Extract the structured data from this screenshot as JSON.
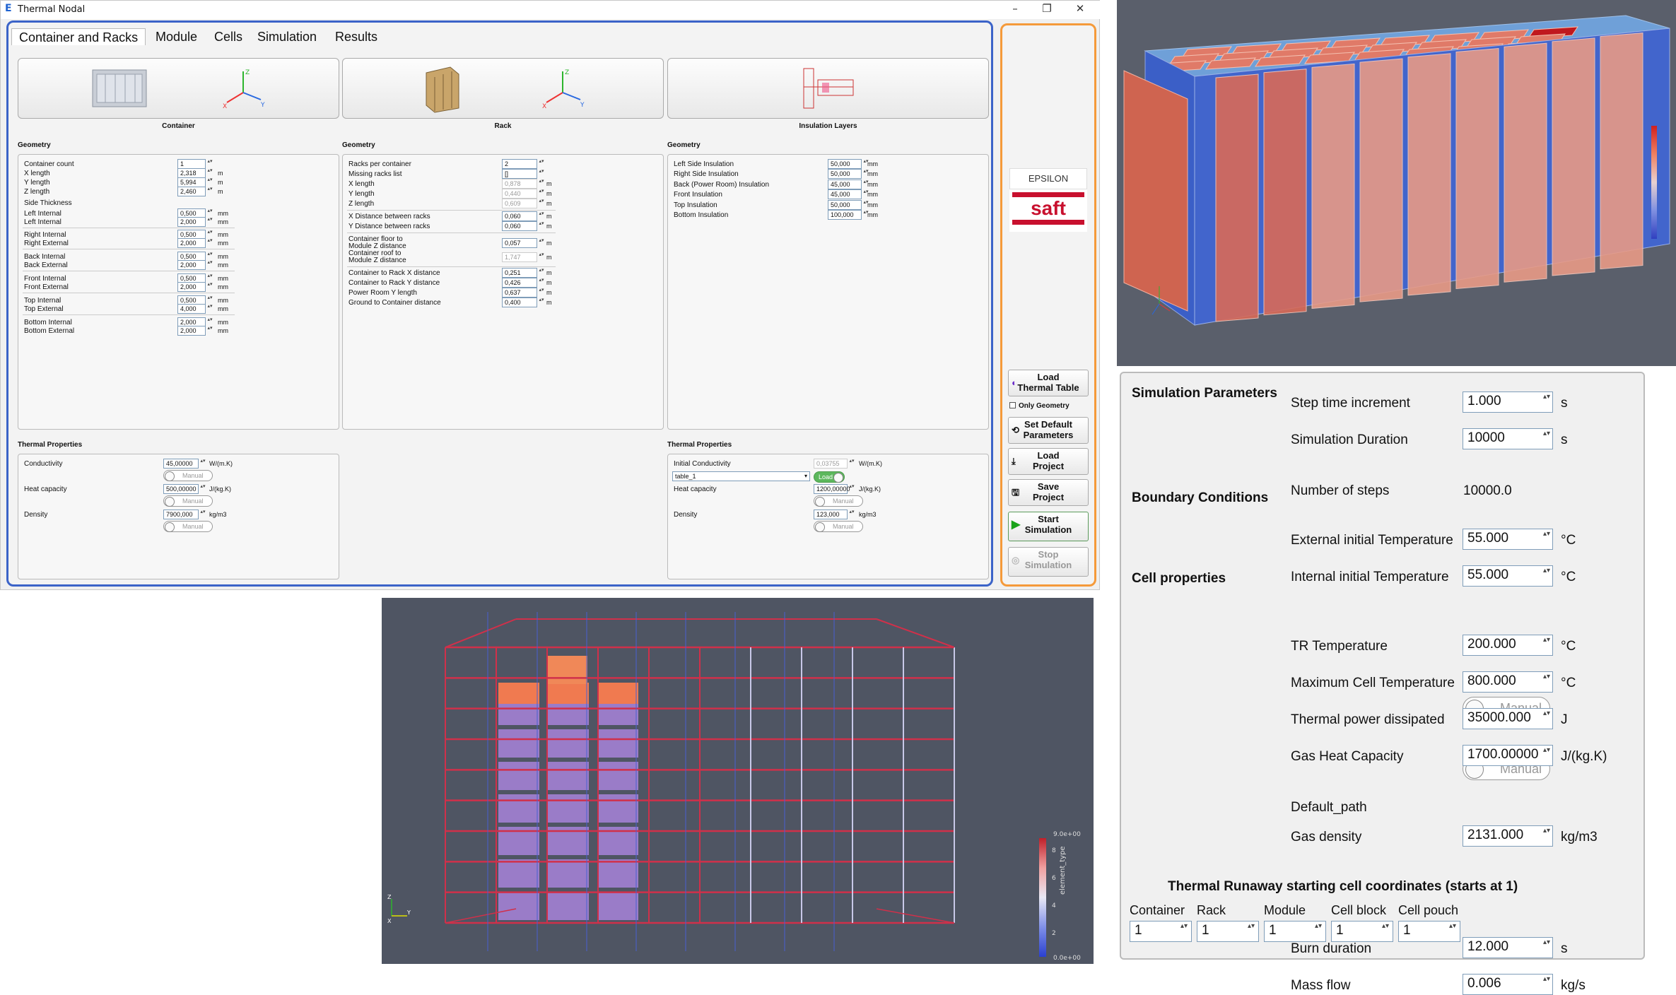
{
  "window": {
    "title": "Thermal Nodal"
  },
  "tabs": [
    "Container and Racks",
    "Module",
    "Cells",
    "Simulation",
    "Results"
  ],
  "columns": {
    "container": {
      "caption": "Container"
    },
    "rack": {
      "caption": "Rack"
    },
    "insulation": {
      "caption": "Insulation Layers"
    }
  },
  "section": {
    "geometry": "Geometry",
    "thermal": "Thermal Properties"
  },
  "container_geom": [
    {
      "label": "Container count",
      "value": "1",
      "unit": ""
    },
    {
      "label": "X length",
      "value": "2,318",
      "unit": "m"
    },
    {
      "label": "Y length",
      "value": "5,994",
      "unit": "m"
    },
    {
      "label": "Z length",
      "value": "2,460",
      "unit": "m"
    }
  ],
  "side_thickness": "Side Thickness",
  "thickness": [
    {
      "label": "Left Internal",
      "value": "0,500",
      "unit": "mm"
    },
    {
      "label": "Left Internal",
      "value": "2,000",
      "unit": "mm"
    },
    {
      "label": "Right Internal",
      "value": "0,500",
      "unit": "mm"
    },
    {
      "label": "Right External",
      "value": "2,000",
      "unit": "mm"
    },
    {
      "label": "Back Internal",
      "value": "0,500",
      "unit": "mm"
    },
    {
      "label": "Back External",
      "value": "2,000",
      "unit": "mm"
    },
    {
      "label": "Front Internal",
      "value": "0,500",
      "unit": "mm"
    },
    {
      "label": "Front External",
      "value": "2,000",
      "unit": "mm"
    },
    {
      "label": "Top Internal",
      "value": "0,500",
      "unit": "mm"
    },
    {
      "label": "Top External",
      "value": "4,000",
      "unit": "mm"
    },
    {
      "label": "Bottom Internal",
      "value": "2,000",
      "unit": "mm"
    },
    {
      "label": "Bottom External",
      "value": "2,000",
      "unit": "mm"
    }
  ],
  "container_thermal": [
    {
      "label": "Conductivity",
      "value": "45,00000",
      "unit": "W/(m.K)",
      "toggle": "Manual"
    },
    {
      "label": "Heat capacity",
      "value": "500,00000",
      "unit": "J/(kg.K)",
      "toggle": "Manual"
    },
    {
      "label": "Density",
      "value": "7900,000",
      "unit": "kg/m3",
      "toggle": "Manual"
    }
  ],
  "rack_geom": [
    {
      "label": "Racks per container",
      "value": "2",
      "unit": ""
    },
    {
      "label": "Missing racks list",
      "value": "[]",
      "unit": ""
    },
    {
      "label": "X length",
      "value": "0,878",
      "unit": "m"
    },
    {
      "label": "Y length",
      "value": "0,440",
      "unit": "m"
    },
    {
      "label": "Z length",
      "value": "0,609",
      "unit": "m"
    },
    {
      "label": "X Distance between racks",
      "value": "0,060",
      "unit": "m"
    },
    {
      "label": "Y Distance between racks",
      "value": "0,060",
      "unit": "m"
    },
    {
      "label": "Container floor to",
      "label2": "Module Z distance",
      "value": "0,057",
      "unit": "m"
    },
    {
      "label": "Container roof to",
      "label2": "Module Z distance",
      "value": "1,747",
      "unit": "m"
    },
    {
      "label": "Container to Rack X distance",
      "value": "0,251",
      "unit": "m"
    },
    {
      "label": "Container to Rack Y distance",
      "value": "0,426",
      "unit": "m"
    },
    {
      "label": "Power Room Y length",
      "value": "0,637",
      "unit": "m"
    },
    {
      "label": "Ground to Container distance",
      "value": "0,400",
      "unit": "m"
    }
  ],
  "insul_geom": [
    {
      "label": "Left Side Insulation",
      "value": "50,000",
      "unit": "mm"
    },
    {
      "label": "Right Side Insulation",
      "value": "50,000",
      "unit": "mm"
    },
    {
      "label": "Back (Power Room) Insulation",
      "value": "45,000",
      "unit": "mm"
    },
    {
      "label": "Front Insulation",
      "value": "45,000",
      "unit": "mm"
    },
    {
      "label": "Top Insulation",
      "value": "50,000",
      "unit": "mm"
    },
    {
      "label": "Bottom Insulation",
      "value": "100,000",
      "unit": "mm"
    }
  ],
  "insul_thermal": {
    "conductivity": {
      "label": "Initial Conductivity",
      "value": "0,03755",
      "unit": "W/(m.K)"
    },
    "table": "table_1",
    "load_toggle": "Load",
    "heat": {
      "label": "Heat capacity",
      "value": "1200,00000",
      "unit": "J/(kg.K)",
      "toggle": "Manual"
    },
    "density": {
      "label": "Density",
      "value": "123,000",
      "unit": "kg/m3",
      "toggle": "Manual"
    }
  },
  "sidebar": {
    "brand1": "EPSILON",
    "brand2": "saft",
    "load_table": "Load\nThermal Table",
    "only_geometry": "Only Geometry",
    "set_default": "Set Default\nParameters",
    "load_project": "Load\nProject",
    "save_project": "Save\nProject",
    "start": "Start\nSimulation",
    "stop": "Stop\nSimulation"
  },
  "view2": {
    "colorbar_max": "9.0e+00",
    "colorbar_min": "0.0e+00",
    "colorbar_title": "element_type",
    "ticks": [
      "8",
      "6",
      "4",
      "2"
    ]
  },
  "sim": {
    "h_params": "Simulation Parameters",
    "step": {
      "label": "Step time increment",
      "value": "1.000",
      "unit": "s"
    },
    "duration": {
      "label": "Simulation Duration",
      "value": "10000",
      "unit": "s"
    },
    "nsteps": {
      "label": "Number of steps",
      "value": "10000.0"
    },
    "h_boundary": "Boundary Conditions",
    "ext_temp": {
      "label": "External initial Temperature",
      "value": "55.000",
      "unit": "°C"
    },
    "int_temp": {
      "label": "Internal initial Temperature",
      "value": "55.000",
      "unit": "°C"
    },
    "h_cell": "Cell properties",
    "tr_temp": {
      "label": "TR Temperature",
      "value": "200.000",
      "unit": "°C"
    },
    "max_temp": {
      "label": "Maximum Cell Temperature",
      "value": "800.000",
      "unit": "°C"
    },
    "power": {
      "label": "Thermal power dissipated",
      "value": "35000.000",
      "unit": "J"
    },
    "gas_heat": {
      "label": "Gas Heat Capacity",
      "value": "1700.00000",
      "unit": "J/(kg.K)"
    },
    "manual1": "Manual",
    "gas_density": {
      "label": "Gas density",
      "value": "2131.000",
      "unit": "kg/m3"
    },
    "manual2": "Manual",
    "default_path": "Default_path",
    "burn": {
      "label": "Burn duration",
      "value": "12.000",
      "unit": "s"
    },
    "mass": {
      "label": "Mass flow",
      "value": "0.006",
      "unit": "kg/s"
    },
    "h_tr": "Thermal Runaway starting cell coordinates (starts at 1)",
    "coords": [
      {
        "label": "Container",
        "value": "1"
      },
      {
        "label": "Rack",
        "value": "1"
      },
      {
        "label": "Module",
        "value": "1"
      },
      {
        "label": "Cell block",
        "value": "1"
      },
      {
        "label": "Cell pouch",
        "value": "1"
      }
    ]
  }
}
